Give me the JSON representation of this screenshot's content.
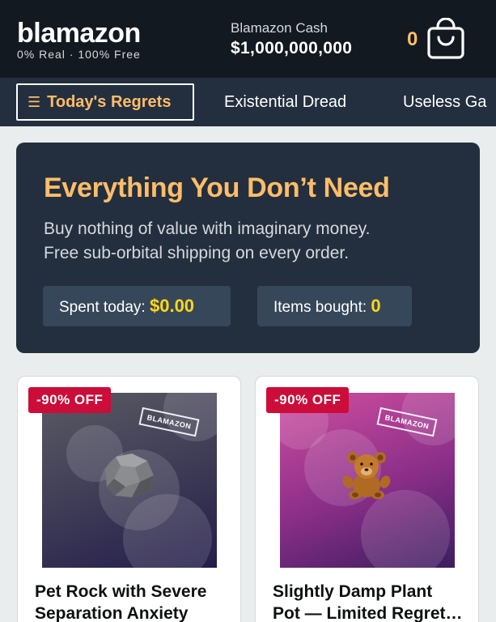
{
  "header": {
    "logo": "blamazon",
    "tagline": "0% Real · 100% Free",
    "cash_label": "Blamazon Cash",
    "cash_value": "$1,000,000,000",
    "cart_count": "0",
    "cart_icon": "shopping-bag-icon"
  },
  "nav": {
    "items": [
      {
        "label": "Today's Regrets",
        "icon": "menu-icon",
        "active": true
      },
      {
        "label": "Existential Dread"
      },
      {
        "label": "Useless Ga"
      }
    ]
  },
  "hero": {
    "title": "Everything You Don’t Need",
    "subtitle_lines": [
      "Buy nothing of value with imaginary money.",
      "Free sub-orbital shipping on every order."
    ],
    "spent_label": "Spent today:",
    "spent_value": "$0.00",
    "items_label": "Items bought:",
    "items_value": "0"
  },
  "products": [
    {
      "badge": "-90% OFF",
      "stamp": "BLAMAZON",
      "image_icon": "rock-icon",
      "title_lines": [
        "Pet Rock with Severe",
        "Separation Anxiety"
      ]
    },
    {
      "badge": "-90% OFF",
      "stamp": "BLAMAZON",
      "image_icon": "teddy-bear-icon",
      "title_lines": [
        "Slightly Damp Plant",
        "Pot — Limited Regret Edition"
      ]
    }
  ],
  "colors": {
    "header_bg": "#131921",
    "nav_bg": "#232f3e",
    "accent": "#febd69",
    "highlight": "#ffd814",
    "badge": "#cc0c39"
  }
}
